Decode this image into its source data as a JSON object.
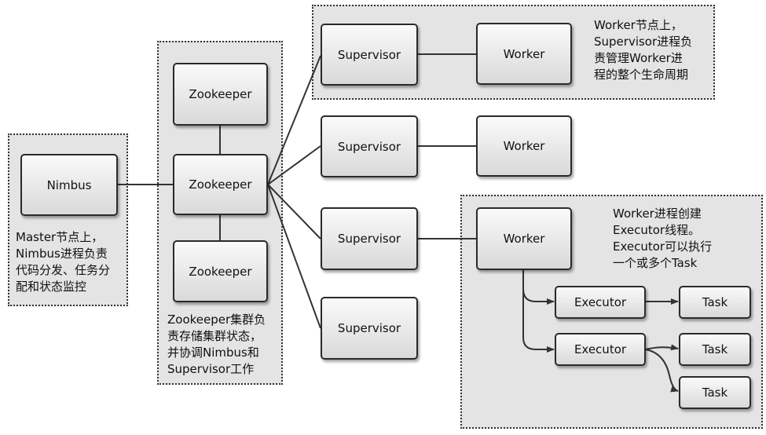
{
  "nodes": {
    "nimbus": "Nimbus",
    "zookeeper_top": "Zookeeper",
    "zookeeper_mid": "Zookeeper",
    "zookeeper_bot": "Zookeeper",
    "supervisor_1": "Supervisor",
    "supervisor_2": "Supervisor",
    "supervisor_3": "Supervisor",
    "supervisor_4": "Supervisor",
    "worker_1": "Worker",
    "worker_2": "Worker",
    "worker_3": "Worker",
    "executor_1": "Executor",
    "executor_2": "Executor",
    "task_1": "Task",
    "task_2": "Task",
    "task_3": "Task"
  },
  "notes": {
    "master": "Master节点上，\nNimbus进程负责\n代码分发、任务分\n配和状态监控",
    "zookeeper": "Zookeeper集群负\n责存储集群状态，\n并协调Nimbus和\nSupervisor工作",
    "worker_node": "Worker节点上，\nSupervisor进程负\n责管理Worker进\n程的整个生命周期",
    "worker_process": "Worker进程创建\nExecutor线程。\nExecutor可以执行\n一个或多个Task"
  },
  "colors": {
    "group_fill": "#e4e4e4",
    "node_border": "#2a2a2a",
    "line": "#333333"
  }
}
